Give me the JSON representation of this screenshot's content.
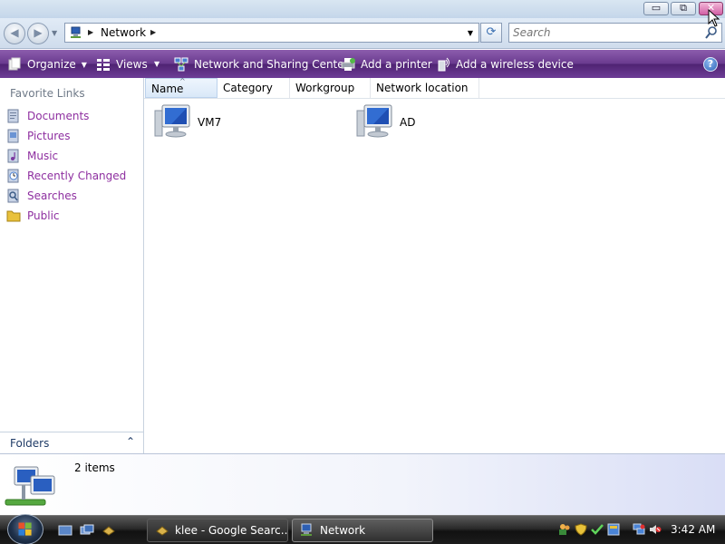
{
  "window": {
    "minimize_icon": "minimize-icon",
    "maximize_icon": "restore-icon",
    "close_icon": "close-icon",
    "min_glyph": "▭",
    "max_glyph": "⧉",
    "close_glyph": "✕"
  },
  "address": {
    "back_glyph": "◀",
    "forward_glyph": "▶",
    "path_label": "Network",
    "refresh_glyph": "⟳",
    "search_placeholder": "Search"
  },
  "commandbar": {
    "organize": "Organize",
    "views": "Views",
    "network_sharing": "Network and Sharing Center",
    "add_printer": "Add a printer",
    "add_wireless": "Add a wireless device",
    "help_glyph": "?",
    "bar_color": "#5b2b84"
  },
  "navpane": {
    "heading": "Favorite Links",
    "links": [
      {
        "label": "Documents",
        "icon": "documents-icon"
      },
      {
        "label": "Pictures",
        "icon": "pictures-icon"
      },
      {
        "label": "Music",
        "icon": "music-icon"
      },
      {
        "label": "Recently Changed",
        "icon": "recently-changed-icon"
      },
      {
        "label": "Searches",
        "icon": "searches-icon"
      },
      {
        "label": "Public",
        "icon": "public-folder-icon"
      }
    ],
    "folders_label": "Folders",
    "folders_chevron": "⌃",
    "link_color": "#8e2fa0"
  },
  "content": {
    "columns": [
      "Name",
      "Category",
      "Workgroup",
      "Network location"
    ],
    "sort_glyph": "^",
    "items": [
      {
        "label": "VM7",
        "icon": "computer-icon"
      },
      {
        "label": "AD",
        "icon": "computer-icon"
      }
    ]
  },
  "details": {
    "count_text": "2 items",
    "icon": "network-icon"
  },
  "taskbar": {
    "tasks": [
      {
        "label": "klee - Google Searc...",
        "icon": "firefox-icon"
      },
      {
        "label": "Network",
        "icon": "network-folder-icon"
      }
    ],
    "clock": "3:42 AM"
  }
}
